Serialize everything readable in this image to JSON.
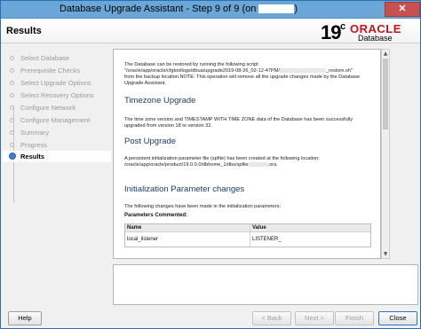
{
  "window": {
    "title": "Database Upgrade Assistant - Step 9 of 9 (on",
    "close_glyph": "✕"
  },
  "header": {
    "heading": "Results",
    "logo_version": "19",
    "logo_version_sup": "c",
    "logo_brand": "ORACLE",
    "logo_sub": "Database"
  },
  "nav": {
    "items": [
      {
        "label": "Select Database"
      },
      {
        "label": "Prerequisite Checks"
      },
      {
        "label": "Select Upgrade Options"
      },
      {
        "label": "Select Recovery Options"
      },
      {
        "label": "Configure Network"
      },
      {
        "label": "Configure Management"
      },
      {
        "label": "Summary"
      },
      {
        "label": "Progress"
      },
      {
        "label": "Results"
      }
    ],
    "active_index": 8
  },
  "content": {
    "restore_line1": "The Database can be restored by running the following script",
    "restore_line2a": "\"/oracle/app/oracle/cfgtoollogs/dbua/upgrade2019-08-26_02-12-47PM/",
    "restore_line2b": "_restore.sh\"",
    "restore_line3": "from the backup location.NOTE: This operation will remove all the upgrade changes made by the Database",
    "restore_line4": "Upgrade Assistant.",
    "tz_heading": "Timezone Upgrade",
    "tz_line1": "The time zone version and TIMESTAMP WITH TIME ZONE data of the Database has been successfully",
    "tz_line2": "upgraded from version 18 to version 32.",
    "post_heading": "Post Upgrade",
    "post_line1": "A persistent initialization parameter file (spfile) has been created at the following location:",
    "post_line2a": "/oracle/app/oracle/product/19.0.0.0/dbhome_1/dbs/spfile",
    "post_line2b": ".ora.",
    "init_heading": "Initialization Parameter changes",
    "init_line1": "The following changes have been made in the initialization parameters:",
    "params_commented": "Parameters Commented:",
    "table": {
      "col_name": "Name",
      "col_value": "Value",
      "rows": [
        {
          "name": "local_listener",
          "value": "LISTENER_"
        }
      ]
    }
  },
  "buttons": {
    "help": "Help",
    "back": "< Back",
    "next": "Next >",
    "finish": "Finish",
    "close": "Close"
  }
}
